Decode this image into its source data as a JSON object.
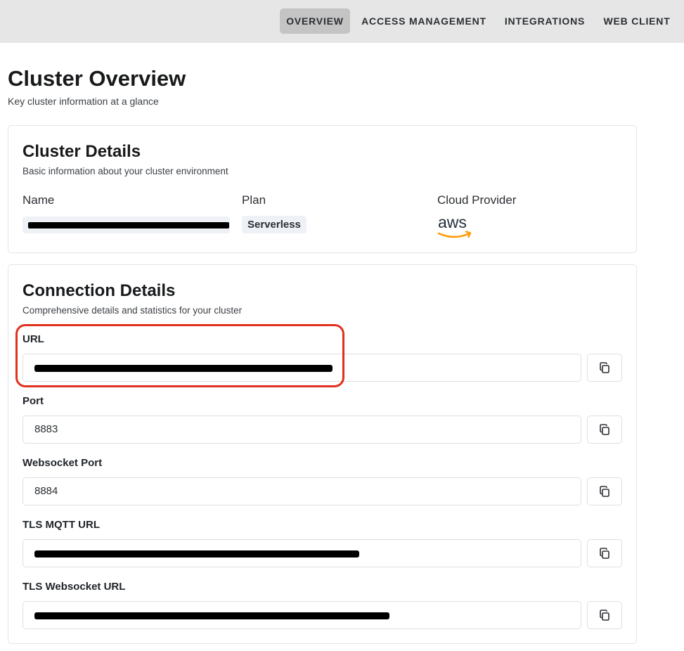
{
  "nav": {
    "tabs": [
      {
        "label": "OVERVIEW",
        "active": true
      },
      {
        "label": "ACCESS MANAGEMENT",
        "active": false
      },
      {
        "label": "INTEGRATIONS",
        "active": false
      },
      {
        "label": "WEB CLIENT",
        "active": false
      }
    ]
  },
  "page": {
    "title": "Cluster Overview",
    "subtitle": "Key cluster information at a glance"
  },
  "cluster_details": {
    "title": "Cluster Details",
    "subtitle": "Basic information about your cluster environment",
    "name_label": "Name",
    "name_value": "",
    "plan_label": "Plan",
    "plan_value": "Serverless",
    "provider_label": "Cloud Provider",
    "provider_logo_text": "aws",
    "provider_icon": "aws-logo-icon"
  },
  "connection_details": {
    "title": "Connection Details",
    "subtitle": "Comprehensive details and statistics for your cluster",
    "fields": [
      {
        "label": "URL",
        "value": "",
        "redacted": true
      },
      {
        "label": "Port",
        "value": "8883",
        "redacted": false
      },
      {
        "label": "Websocket Port",
        "value": "8884",
        "redacted": false
      },
      {
        "label": "TLS MQTT URL",
        "value": "",
        "redacted": true
      },
      {
        "label": "TLS Websocket URL",
        "value": "",
        "redacted": true
      }
    ],
    "copy_icon": "copy-icon"
  },
  "colors": {
    "accent_highlight": "#e0301e",
    "aws_orange": "#ff9900",
    "topbar_bg": "#e6e6e6",
    "active_tab_bg": "#c4c4c4"
  }
}
